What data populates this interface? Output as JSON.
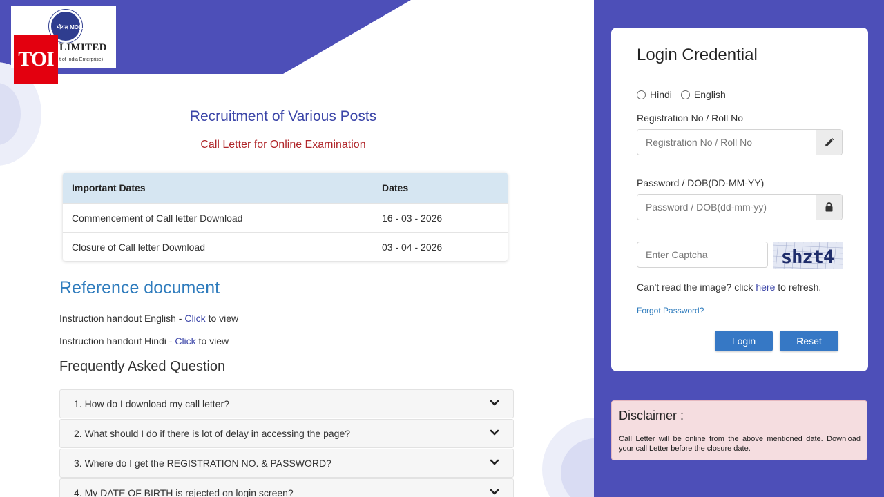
{
  "colors": {
    "banner": "#4d4fb8",
    "title": "#3b45a8",
    "subtitle": "#b0262a",
    "table_header": "#d6e6f2",
    "link": "#3b45a8",
    "button": "#3678c5",
    "disclaimer_bg": "#f5dde0",
    "toi_red": "#e3000f"
  },
  "logo": {
    "emblem_text": "मॉयल MOIL",
    "name": "LIMITED",
    "subtext": "t of India Enterprise)"
  },
  "toi_badge": "TOI",
  "header": {
    "title": "Recruitment of Various Posts",
    "subtitle": "Call Letter for Online Examination"
  },
  "dates_table": {
    "headers": [
      "Important Dates",
      "Dates"
    ],
    "rows": [
      [
        "Commencement of Call letter Download",
        "16 - 03 - 2026"
      ],
      [
        "Closure of Call letter Download",
        "03 - 04 - 2026"
      ]
    ]
  },
  "reference": {
    "heading": "Reference document",
    "items": [
      {
        "prefix": "Instruction handout English - ",
        "link": "Click",
        "suffix": " to view"
      },
      {
        "prefix": "Instruction handout Hindi - ",
        "link": "Click",
        "suffix": " to view"
      }
    ]
  },
  "faq": {
    "heading": "Frequently Asked Question",
    "items": [
      "1. How do I download my call letter?",
      "2. What should I do if there is lot of delay in accessing the page?",
      "3. Where do I get the REGISTRATION NO. & PASSWORD?",
      "4. My DATE OF BIRTH is rejected on login screen?"
    ]
  },
  "login": {
    "title": "Login Credential",
    "languages": [
      "Hindi",
      "English"
    ],
    "reg_label": "Registration No / Roll No",
    "reg_placeholder": "Registration No / Roll No",
    "reg_icon": "pencil-icon",
    "pwd_label": "Password / DOB(DD-MM-YY)",
    "pwd_placeholder": "Password / DOB(dd-mm-yy)",
    "pwd_icon": "lock-icon",
    "captcha_placeholder": "Enter Captcha",
    "captcha_text": "shzt4",
    "refresh_prefix": "Can't read the image? click ",
    "refresh_link": "here",
    "refresh_suffix": " to refresh.",
    "forgot": "Forgot Password?",
    "login_button": "Login",
    "reset_button": "Reset"
  },
  "disclaimer": {
    "title": "Disclaimer :",
    "text": "Call Letter will be online from the above mentioned date. Download your call Letter before the closure date."
  }
}
